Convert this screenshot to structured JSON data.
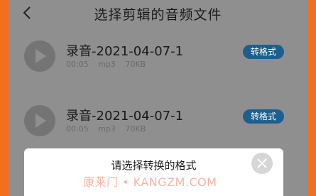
{
  "header": {
    "title": "选择剪辑的音频文件"
  },
  "items": [
    {
      "name": "录音-2021-04-07-1",
      "duration": "00:05",
      "format": "mp3",
      "size": "70KB",
      "convert_label": "转格式"
    },
    {
      "name": "录音-2021-04-07-1",
      "duration": "00:05",
      "format": "mp3",
      "size": "70KB",
      "convert_label": "转格式"
    }
  ],
  "dialog": {
    "title": "请选择转换的格式"
  },
  "watermark": {
    "text": "康莱门 • KANGZM.COM"
  },
  "colors": {
    "frame": "#ff7f2a",
    "overlay": "#8f8f8f",
    "convert_button": "#1c5f8f",
    "dialog_bg": "#ffffff"
  },
  "icons": {
    "back": "chevron-left-icon",
    "play": "play-icon",
    "close": "close-icon"
  }
}
